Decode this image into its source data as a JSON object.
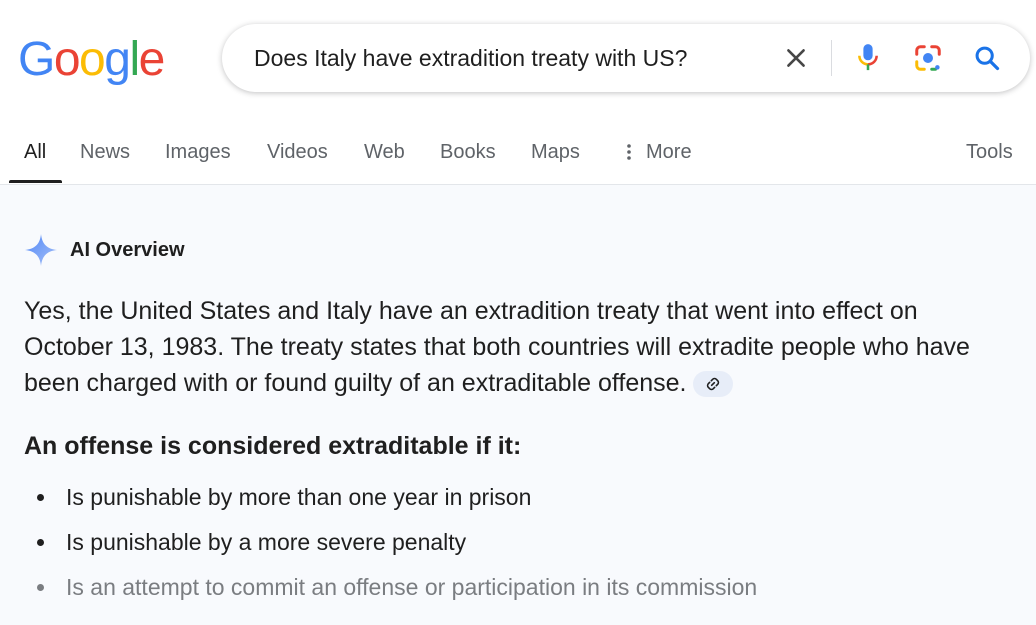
{
  "logo": {
    "letters": [
      "G",
      "o",
      "o",
      "g",
      "l",
      "e"
    ],
    "colors": [
      "#4285f4",
      "#ea4335",
      "#fbbc05",
      "#4285f4",
      "#34a853",
      "#ea4335"
    ]
  },
  "search": {
    "query": "Does Italy have extradition treaty with US?"
  },
  "icons": {
    "clear": "close-icon",
    "voice": "microphone-icon",
    "lens": "camera-lens-icon",
    "search": "search-icon",
    "more": "vertical-dots-icon",
    "ai": "sparkle-icon",
    "cite": "link-icon"
  },
  "tabs": {
    "all": "All",
    "news": "News",
    "images": "Images",
    "videos": "Videos",
    "web": "Web",
    "books": "Books",
    "maps": "Maps",
    "more": "More",
    "tools": "Tools"
  },
  "ai_overview": {
    "label": "AI Overview",
    "answer": "Yes, the United States and Italy have an extradition treaty that went into effect on October 13, 1983. The treaty states that both countries will extradite people who have been charged with or found guilty of an extraditable offense.",
    "subheading": "An offense is considered extraditable if it:",
    "bullets": [
      "Is punishable by more than one year in prison",
      "Is punishable by a more severe penalty",
      "Is an attempt to commit an offense or participation in its commission"
    ]
  },
  "colors": {
    "accent": "#1a73e8",
    "panel_bg": "#f8fafd",
    "chip_bg": "#e7edf8"
  }
}
